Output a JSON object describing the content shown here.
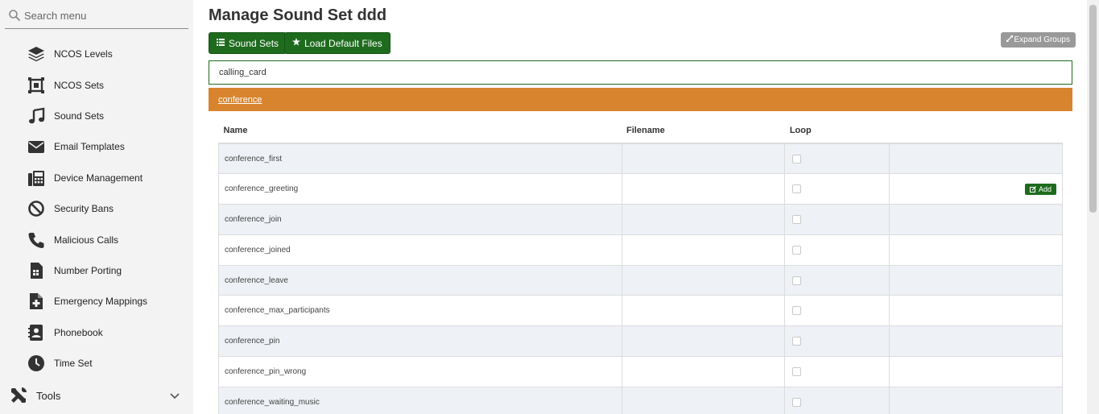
{
  "search": {
    "placeholder": "Search menu"
  },
  "sidebar": {
    "items": [
      {
        "label": "NCOS Levels",
        "icon": "layers-icon"
      },
      {
        "label": "NCOS Sets",
        "icon": "crop-frame-icon"
      },
      {
        "label": "Sound Sets",
        "icon": "music-note-icon"
      },
      {
        "label": "Email Templates",
        "icon": "envelope-icon"
      },
      {
        "label": "Device Management",
        "icon": "fax-icon"
      },
      {
        "label": "Security Bans",
        "icon": "ban-icon"
      },
      {
        "label": "Malicious Calls",
        "icon": "phone-icon"
      },
      {
        "label": "Number Porting",
        "icon": "sim-card-icon"
      },
      {
        "label": "Emergency Mappings",
        "icon": "medical-file-icon"
      },
      {
        "label": "Phonebook",
        "icon": "contact-book-icon"
      },
      {
        "label": "Time Set",
        "icon": "clock-icon"
      }
    ],
    "tools": {
      "label": "Tools",
      "icon": "tools-icon"
    }
  },
  "page": {
    "title": "Manage Sound Set ddd",
    "btn_sound_sets": "Sound Sets",
    "btn_load_default": "Load Default Files",
    "btn_expand": "Expand Groups"
  },
  "groups": {
    "collapsed": "calling_card",
    "open": "conference"
  },
  "table": {
    "headers": [
      "Name",
      "Filename",
      "Loop",
      ""
    ],
    "add_label": "Add",
    "rows": [
      {
        "name": "conference_first",
        "filename": "",
        "has_add": false
      },
      {
        "name": "conference_greeting",
        "filename": "",
        "has_add": true
      },
      {
        "name": "conference_join",
        "filename": "",
        "has_add": false
      },
      {
        "name": "conference_joined",
        "filename": "",
        "has_add": false
      },
      {
        "name": "conference_leave",
        "filename": "",
        "has_add": false
      },
      {
        "name": "conference_max_participants",
        "filename": "",
        "has_add": false
      },
      {
        "name": "conference_pin",
        "filename": "",
        "has_add": false
      },
      {
        "name": "conference_pin_wrong",
        "filename": "",
        "has_add": false
      },
      {
        "name": "conference_waiting_music",
        "filename": "",
        "has_add": false
      }
    ]
  },
  "colors": {
    "green": "#1e6b1e",
    "orange": "#d8842e",
    "sidebar_bg": "#f3f3f3"
  }
}
